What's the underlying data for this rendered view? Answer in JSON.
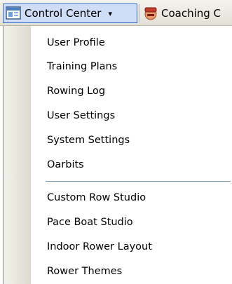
{
  "toolbar": {
    "control_center_label": "Control Center",
    "control_center_arrow": "▾",
    "coaching_label": "Coaching C"
  },
  "menu": {
    "group1": [
      {
        "label": "User Profile"
      },
      {
        "label": "Training Plans"
      },
      {
        "label": "Rowing Log"
      },
      {
        "label": "User Settings"
      },
      {
        "label": "System Settings"
      },
      {
        "label": "Oarbits"
      }
    ],
    "group2": [
      {
        "label": "Custom Row Studio"
      },
      {
        "label": "Pace Boat Studio"
      },
      {
        "label": "Indoor Rower Layout"
      },
      {
        "label": "Rower Themes"
      }
    ]
  }
}
